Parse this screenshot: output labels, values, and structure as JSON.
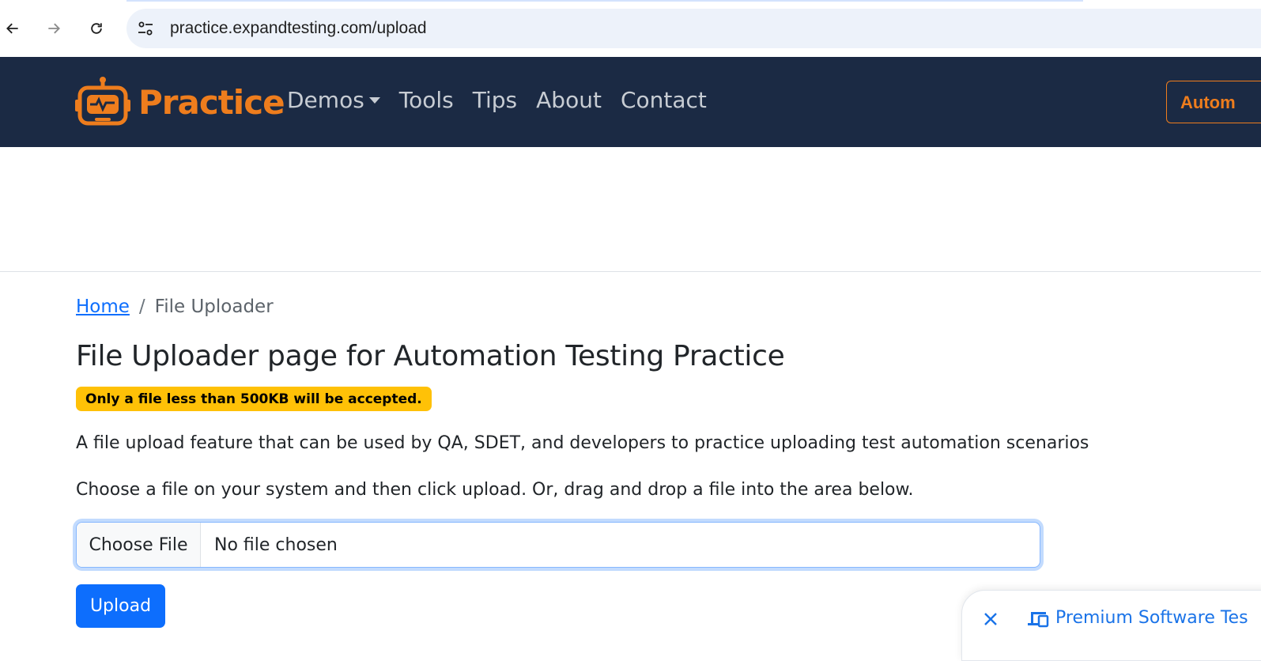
{
  "browser": {
    "url": "practice.expandtesting.com/upload",
    "back_icon": "arrow-left-icon",
    "forward_icon": "arrow-right-icon",
    "reload_icon": "reload-icon",
    "site_info_icon": "tune-icon"
  },
  "navbar": {
    "brand": "Practice",
    "links": [
      "Demos",
      "Tools",
      "Tips",
      "About",
      "Contact"
    ],
    "cta_label": "Autom",
    "colors": {
      "background": "#1b2a44",
      "brand": "#ee7d1d",
      "link": "#c7ccd3"
    }
  },
  "breadcrumb": {
    "home": "Home",
    "separator": "/",
    "current": "File Uploader"
  },
  "main": {
    "title": "File Uploader page for Automation Testing Practice",
    "badge": "Only a file less than 500KB will be accepted.",
    "paragraph1": "A file upload feature that can be used by QA, SDET, and developers to practice uploading test automation scenarios",
    "paragraph2": "Choose a file on your system and then click upload. Or, drag and drop a file into the area below.",
    "file_button": "Choose File",
    "file_status": "No file chosen",
    "upload_label": "Upload",
    "colors": {
      "badge": "#ffc107",
      "primary": "#0d6efd",
      "link": "#0d6efd"
    }
  },
  "toast": {
    "text": "Premium Software Tes",
    "close_icon": "close-icon",
    "device_icon": "devices-icon"
  }
}
